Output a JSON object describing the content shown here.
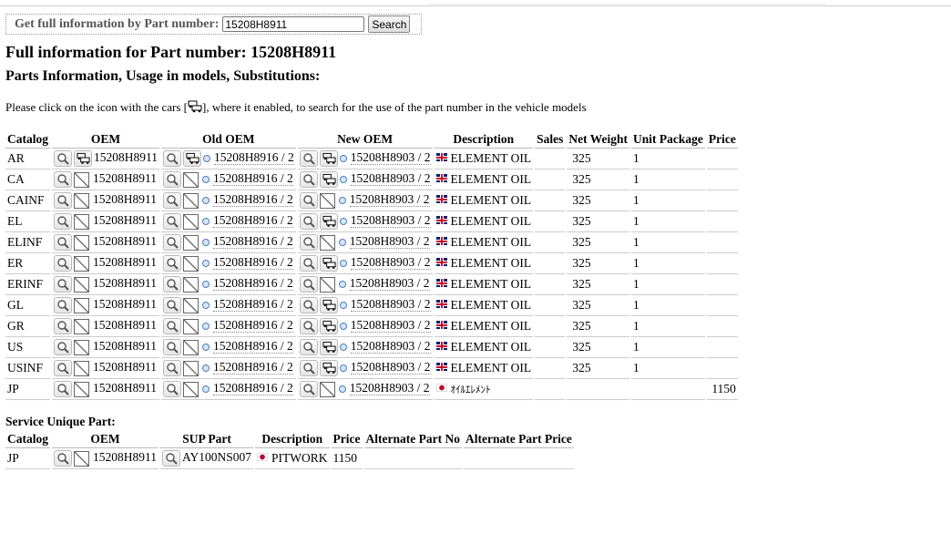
{
  "search": {
    "label": "Get full information by Part number:",
    "value": "15208H8911",
    "button": "Search"
  },
  "heading": "Full information for Part number: 15208H8911",
  "subheading": "Parts Information, Usage in models, Substitutions:",
  "note_before": "Please click on the icon with the cars [",
  "note_after": "], where it enabled, to search for the use of the part number in the vehicle models",
  "main_table": {
    "headers": [
      "Catalog",
      "OEM",
      "Old OEM",
      "New OEM",
      "Description",
      "Sales",
      "Net Weight",
      "Unit Package",
      "Price"
    ],
    "rows": [
      {
        "catalog": "AR",
        "oem": "15208H8911",
        "oem_cars": true,
        "old": "15208H8916 / 2",
        "old_cars": true,
        "new": "15208H8903 / 2",
        "new_cars": true,
        "flag": "uk",
        "desc": "ELEMENT OIL",
        "sales": "",
        "weight": "325",
        "unit": "1",
        "price": ""
      },
      {
        "catalog": "CA",
        "oem": "15208H8911",
        "oem_cars": false,
        "old": "15208H8916 / 2",
        "old_cars": false,
        "new": "15208H8903 / 2",
        "new_cars": true,
        "flag": "uk",
        "desc": "ELEMENT OIL",
        "sales": "",
        "weight": "325",
        "unit": "1",
        "price": ""
      },
      {
        "catalog": "CAINF",
        "oem": "15208H8911",
        "oem_cars": false,
        "old": "15208H8916 / 2",
        "old_cars": false,
        "new": "15208H8903 / 2",
        "new_cars": false,
        "flag": "uk",
        "desc": "ELEMENT OIL",
        "sales": "",
        "weight": "325",
        "unit": "1",
        "price": ""
      },
      {
        "catalog": "EL",
        "oem": "15208H8911",
        "oem_cars": false,
        "old": "15208H8916 / 2",
        "old_cars": false,
        "new": "15208H8903 / 2",
        "new_cars": true,
        "flag": "uk",
        "desc": "ELEMENT OIL",
        "sales": "",
        "weight": "325",
        "unit": "1",
        "price": ""
      },
      {
        "catalog": "ELINF",
        "oem": "15208H8911",
        "oem_cars": false,
        "old": "15208H8916 / 2",
        "old_cars": false,
        "new": "15208H8903 / 2",
        "new_cars": false,
        "flag": "uk",
        "desc": "ELEMENT OIL",
        "sales": "",
        "weight": "325",
        "unit": "1",
        "price": ""
      },
      {
        "catalog": "ER",
        "oem": "15208H8911",
        "oem_cars": false,
        "old": "15208H8916 / 2",
        "old_cars": false,
        "new": "15208H8903 / 2",
        "new_cars": true,
        "flag": "uk",
        "desc": "ELEMENT OIL",
        "sales": "",
        "weight": "325",
        "unit": "1",
        "price": ""
      },
      {
        "catalog": "ERINF",
        "oem": "15208H8911",
        "oem_cars": false,
        "old": "15208H8916 / 2",
        "old_cars": false,
        "new": "15208H8903 / 2",
        "new_cars": false,
        "flag": "uk",
        "desc": "ELEMENT OIL",
        "sales": "",
        "weight": "325",
        "unit": "1",
        "price": ""
      },
      {
        "catalog": "GL",
        "oem": "15208H8911",
        "oem_cars": false,
        "old": "15208H8916 / 2",
        "old_cars": false,
        "new": "15208H8903 / 2",
        "new_cars": true,
        "flag": "uk",
        "desc": "ELEMENT OIL",
        "sales": "",
        "weight": "325",
        "unit": "1",
        "price": ""
      },
      {
        "catalog": "GR",
        "oem": "15208H8911",
        "oem_cars": false,
        "old": "15208H8916 / 2",
        "old_cars": false,
        "new": "15208H8903 / 2",
        "new_cars": true,
        "flag": "uk",
        "desc": "ELEMENT OIL",
        "sales": "",
        "weight": "325",
        "unit": "1",
        "price": ""
      },
      {
        "catalog": "US",
        "oem": "15208H8911",
        "oem_cars": false,
        "old": "15208H8916 / 2",
        "old_cars": false,
        "new": "15208H8903 / 2",
        "new_cars": true,
        "flag": "uk",
        "desc": "ELEMENT OIL",
        "sales": "",
        "weight": "325",
        "unit": "1",
        "price": ""
      },
      {
        "catalog": "USINF",
        "oem": "15208H8911",
        "oem_cars": false,
        "old": "15208H8916 / 2",
        "old_cars": false,
        "new": "15208H8903 / 2",
        "new_cars": true,
        "flag": "uk",
        "desc": "ELEMENT OIL",
        "sales": "",
        "weight": "325",
        "unit": "1",
        "price": ""
      },
      {
        "catalog": "JP",
        "oem": "15208H8911",
        "oem_cars": false,
        "old": "15208H8916 / 2",
        "old_cars": false,
        "new": "15208H8903 / 2",
        "new_cars": false,
        "flag": "jp",
        "desc": "ｵｲﾙｴﾚﾒﾝﾄ",
        "sales": "",
        "weight": "",
        "unit": "",
        "price": "1150"
      }
    ]
  },
  "service_title": "Service Unique Part:",
  "sup_table": {
    "headers": [
      "Catalog",
      "OEM",
      "SUP Part",
      "Description",
      "Price",
      "Alternate Part No",
      "Alternate Part Price"
    ],
    "rows": [
      {
        "catalog": "JP",
        "oem": "15208H8911",
        "sup": "AY100NS007",
        "flag": "jp",
        "desc": "PITWORK",
        "price": "1150",
        "alt": "",
        "alt_price": ""
      }
    ]
  },
  "icons": {
    "search": "magnifier-icon",
    "cars": "cars-icon",
    "unavailable": "no-image-icon",
    "info": "info-icon",
    "flag_uk": "uk-flag-icon",
    "flag_jp": "jp-flag-icon"
  }
}
